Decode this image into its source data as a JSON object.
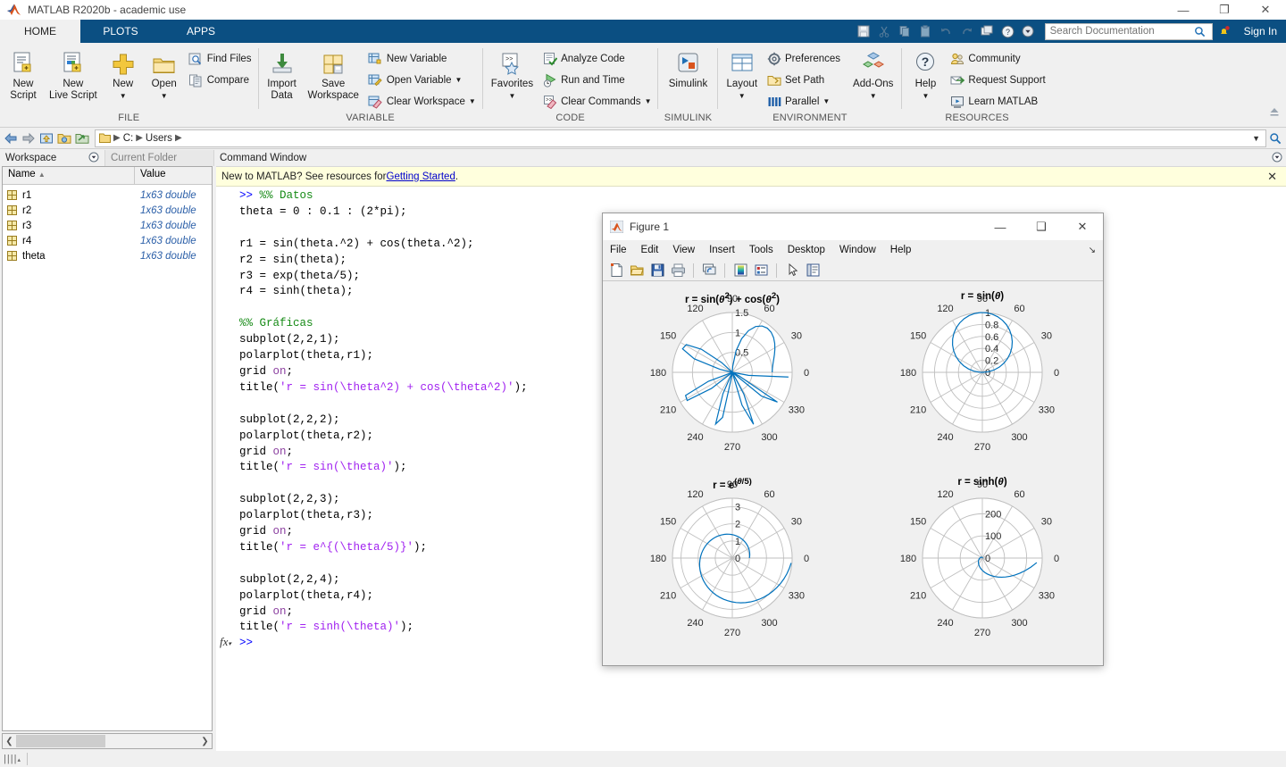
{
  "window": {
    "title": "MATLAB R2020b - academic use",
    "minimize": "—",
    "restore": "❐",
    "close": "✕"
  },
  "tabs": [
    {
      "label": "HOME",
      "active": true
    },
    {
      "label": "PLOTS",
      "active": false
    },
    {
      "label": "APPS",
      "active": false
    }
  ],
  "quick_access": {
    "icons": [
      "save-icon",
      "cut-icon",
      "copy-icon",
      "paste-icon",
      "undo-icon",
      "redo-icon",
      "switch-window-icon",
      "help-icon",
      "customize-icon"
    ],
    "search_placeholder": "Search Documentation",
    "sign_in": "Sign In",
    "notification_icon": "bell-icon",
    "search_icon": "magnifier-icon"
  },
  "ribbon": {
    "groups": [
      {
        "label": "FILE",
        "big": [
          {
            "name": "new-script",
            "line1": "New",
            "line2": "Script",
            "icon": "new-script-icon",
            "caret": false
          },
          {
            "name": "new-live-script",
            "line1": "New",
            "line2": "Live Script",
            "icon": "new-live-script-icon",
            "caret": false
          },
          {
            "name": "new",
            "line1": "New",
            "line2": "",
            "icon": "plus-icon",
            "caret": true
          },
          {
            "name": "open",
            "line1": "Open",
            "line2": "",
            "icon": "folder-icon",
            "caret": true
          }
        ],
        "small": [
          {
            "name": "find-files",
            "label": "Find Files",
            "icon": "find-files-icon",
            "caret": false
          },
          {
            "name": "compare",
            "label": "Compare",
            "icon": "compare-icon",
            "caret": false
          }
        ]
      },
      {
        "label": "VARIABLE",
        "big": [
          {
            "name": "import-data",
            "line1": "Import",
            "line2": "Data",
            "icon": "import-data-icon",
            "caret": false
          },
          {
            "name": "save-workspace",
            "line1": "Save",
            "line2": "Workspace",
            "icon": "save-workspace-icon",
            "caret": false
          }
        ],
        "small": [
          {
            "name": "new-variable",
            "label": "New Variable",
            "icon": "new-variable-icon",
            "caret": false
          },
          {
            "name": "open-variable",
            "label": "Open Variable",
            "icon": "open-variable-icon",
            "caret": true
          },
          {
            "name": "clear-workspace",
            "label": "Clear Workspace",
            "icon": "clear-workspace-icon",
            "caret": true
          }
        ]
      },
      {
        "label": "CODE",
        "big": [
          {
            "name": "favorites",
            "line1": "Favorites",
            "line2": "",
            "icon": "favorites-icon",
            "caret": true
          }
        ],
        "small": [
          {
            "name": "analyze-code",
            "label": "Analyze Code",
            "icon": "analyze-code-icon",
            "caret": false
          },
          {
            "name": "run-and-time",
            "label": "Run and Time",
            "icon": "run-and-time-icon",
            "caret": false
          },
          {
            "name": "clear-commands",
            "label": "Clear Commands",
            "icon": "clear-commands-icon",
            "caret": true
          }
        ]
      },
      {
        "label": "SIMULINK",
        "big": [
          {
            "name": "simulink",
            "line1": "Simulink",
            "line2": "",
            "icon": "simulink-icon",
            "caret": false
          }
        ],
        "small": []
      },
      {
        "label": "ENVIRONMENT",
        "big": [
          {
            "name": "layout",
            "line1": "Layout",
            "line2": "",
            "icon": "layout-icon",
            "caret": true
          },
          {
            "name": "add-ons",
            "line1": "Add-Ons",
            "line2": "",
            "icon": "add-ons-icon",
            "caret": true
          }
        ],
        "small": [
          {
            "name": "preferences",
            "label": "Preferences",
            "icon": "preferences-icon",
            "caret": false
          },
          {
            "name": "set-path",
            "label": "Set Path",
            "icon": "set-path-icon",
            "caret": false
          },
          {
            "name": "parallel",
            "label": "Parallel",
            "icon": "parallel-icon",
            "caret": true
          }
        ]
      },
      {
        "label": "RESOURCES",
        "big": [
          {
            "name": "help",
            "line1": "Help",
            "line2": "",
            "icon": "help-icon",
            "caret": true
          }
        ],
        "small": [
          {
            "name": "community",
            "label": "Community",
            "icon": "community-icon",
            "caret": false
          },
          {
            "name": "request-support",
            "label": "Request Support",
            "icon": "request-support-icon",
            "caret": false
          },
          {
            "name": "learn-matlab",
            "label": "Learn MATLAB",
            "icon": "learn-matlab-icon",
            "caret": false
          }
        ]
      }
    ],
    "collapse_icon": "collapse-ribbon-icon"
  },
  "address_bar": {
    "back_icon": "back-arrow-icon",
    "forward_icon": "forward-arrow-icon",
    "up_icon": "up-folder-icon",
    "browse_icon": "browse-folder-icon",
    "refresh_icon": "refresh-icon",
    "folder_icon": "folder-icon",
    "crumbs": [
      "C:",
      "Users"
    ],
    "dropdown_icon": "chevron-down-icon",
    "search_icon": "magnifier-icon"
  },
  "left_panel": {
    "tabs": [
      {
        "label": "Workspace",
        "active": true,
        "dropdown": "panel-options-icon"
      },
      {
        "label": "Current Folder",
        "active": false
      }
    ],
    "columns": [
      "Name",
      "Value"
    ],
    "sort_icon": "sort-ascending-icon",
    "rows": [
      {
        "name": "r1",
        "value": "1x63 double"
      },
      {
        "name": "r2",
        "value": "1x63 double"
      },
      {
        "name": "r3",
        "value": "1x63 double"
      },
      {
        "name": "r4",
        "value": "1x63 double"
      },
      {
        "name": "theta",
        "value": "1x63 double"
      }
    ]
  },
  "command_window": {
    "title": "Command Window",
    "dropdown_icon": "panel-options-icon",
    "banner_prefix": "New to MATLAB? See resources for ",
    "banner_link": "Getting Started",
    "banner_suffix": ".",
    "banner_close": "✕",
    "prompt": ">>",
    "fx_label": "fx",
    "lines": [
      ">> %% Datos",
      "theta = 0 : 0.1 : (2*pi);",
      "",
      "r1 = sin(theta.^2) + cos(theta.^2);",
      "r2 = sin(theta);",
      "r3 = exp(theta/5);",
      "r4 = sinh(theta);",
      "",
      "%% Gráficas",
      "subplot(2,2,1);",
      "polarplot(theta,r1);",
      "grid on;",
      "title('r = sin(\\theta^2) + cos(\\theta^2)');",
      "",
      "subplot(2,2,2);",
      "polarplot(theta,r2);",
      "grid on;",
      "title('r = sin(\\theta)');",
      "",
      "subplot(2,2,3);",
      "polarplot(theta,r3);",
      "grid on;",
      "title('r = e^{(\\theta/5)}');",
      "",
      "subplot(2,2,4);",
      "polarplot(theta,r4);",
      "grid on;",
      "title('r = sinh(\\theta)');",
      ">>"
    ]
  },
  "figure_window": {
    "title": "Figure 1",
    "minimize": "—",
    "maximize": "❑",
    "close": "✕",
    "menus": [
      "File",
      "Edit",
      "View",
      "Insert",
      "Tools",
      "Desktop",
      "Window",
      "Help"
    ],
    "menu_arrow": "↘",
    "toolbar_icons": [
      "new-figure-icon",
      "open-figure-icon",
      "save-figure-icon",
      "print-icon",
      "link-plot-icon",
      "colorbar-icon",
      "legend-icon",
      "edit-plot-icon",
      "property-inspector-icon"
    ]
  },
  "chart_data": [
    {
      "type": "line",
      "subtype": "polar",
      "position": "top-left",
      "title": "r = sin(θ²) + cos(θ²)",
      "theta_ticks": [
        0,
        30,
        60,
        90,
        120,
        150,
        180,
        210,
        240,
        270,
        300,
        330
      ],
      "r_ticks": [
        0.5,
        1,
        1.5
      ],
      "r_tick_labels": [
        "0.5",
        "1",
        "1.5"
      ],
      "rlim": [
        0,
        1.5
      ],
      "grid": true,
      "line_color": "#0072BD",
      "expression": "sin(theta.^2) + cos(theta.^2)",
      "theta_start": 0,
      "theta_step": 0.1,
      "theta_end": 6.283185
    },
    {
      "type": "line",
      "subtype": "polar",
      "position": "top-right",
      "title": "r = sin(θ)",
      "theta_ticks": [
        0,
        30,
        60,
        90,
        120,
        150,
        180,
        210,
        240,
        270,
        300,
        330
      ],
      "r_ticks": [
        0,
        0.2,
        0.4,
        0.6,
        0.8,
        1
      ],
      "r_tick_labels": [
        "0",
        "0.2",
        "0.4",
        "0.6",
        "0.8",
        "1"
      ],
      "rlim": [
        0,
        1
      ],
      "grid": true,
      "line_color": "#0072BD",
      "expression": "sin(theta)",
      "theta_start": 0,
      "theta_step": 0.1,
      "theta_end": 6.283185
    },
    {
      "type": "line",
      "subtype": "polar",
      "position": "bottom-left",
      "title": "r = e^(θ/5)",
      "theta_ticks": [
        0,
        30,
        60,
        90,
        120,
        150,
        180,
        210,
        240,
        270,
        300,
        330
      ],
      "r_ticks": [
        0,
        1,
        2,
        3
      ],
      "r_tick_labels": [
        "0",
        "1",
        "2",
        "3"
      ],
      "rlim": [
        0,
        3.5
      ],
      "grid": true,
      "line_color": "#0072BD",
      "expression": "exp(theta/5)",
      "theta_start": 0,
      "theta_step": 0.1,
      "theta_end": 6.283185
    },
    {
      "type": "line",
      "subtype": "polar",
      "position": "bottom-right",
      "title": "r = sinh(θ)",
      "theta_ticks": [
        0,
        30,
        60,
        90,
        120,
        150,
        180,
        210,
        240,
        270,
        300,
        330
      ],
      "r_ticks": [
        0,
        100,
        200
      ],
      "r_tick_labels": [
        "0",
        "100",
        "200"
      ],
      "rlim": [
        0,
        270
      ],
      "grid": true,
      "line_color": "#0072BD",
      "expression": "sinh(theta)",
      "theta_start": 0,
      "theta_step": 0.1,
      "theta_end": 6.283185
    }
  ],
  "status_bar": {
    "grip_icon": "resize-grip-icon"
  }
}
